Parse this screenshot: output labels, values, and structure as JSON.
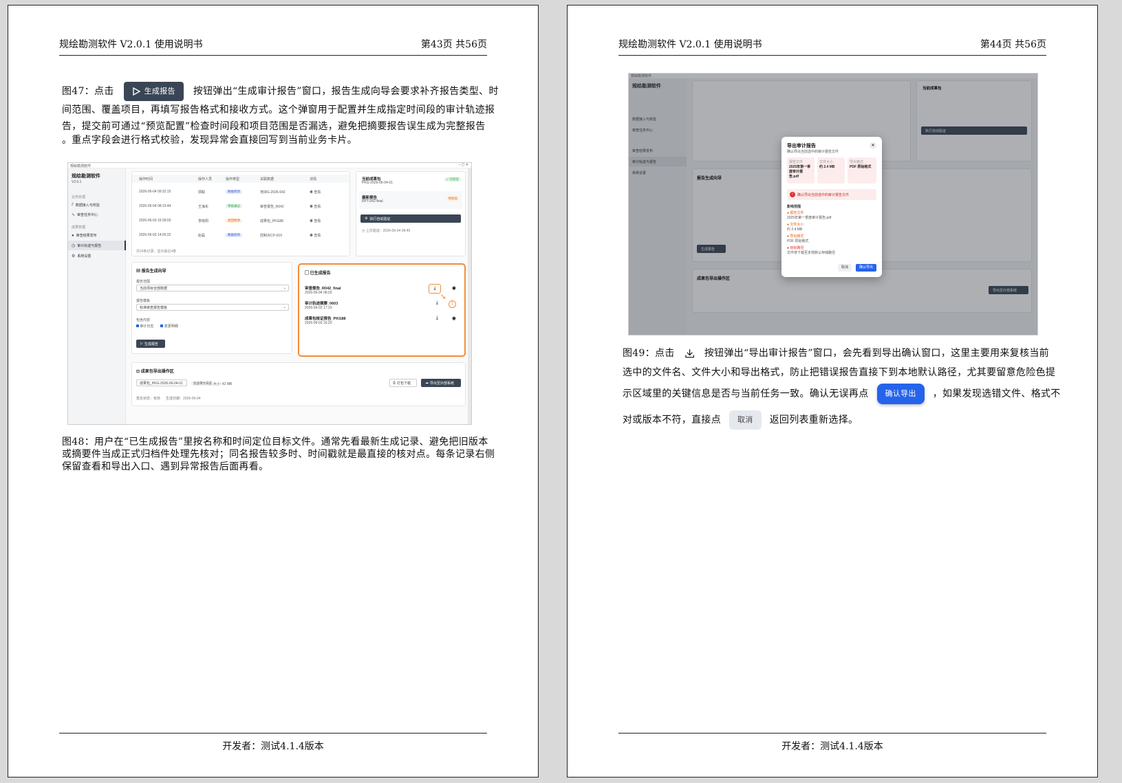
{
  "doc_title": "规绘勘测软件 V2.0.1 使用说明书",
  "footer": "开发者：测试4.1.4版本",
  "left_page": {
    "page_num": "第43页  共56页",
    "fig47": {
      "prefix": "图47：点击",
      "button_label": "生成报告",
      "line1_rest": "按钮弹出“生成审计报告”窗口，报告生成向导会要求补齐报告类型、时",
      "line2": "间范围、覆盖项目，再填写报告格式和接收方式。这个弹窗用于配置并生成指定时间段的审计轨迹报",
      "line3": "告，提交前可通过“预览配置”检查时间段和项目范围是否漏选，避免把摘要报告误生成为完整报告",
      "line4": "。重点字段会进行格式校验，发现异常会直接回写到当前业务卡片。"
    },
    "fig48": {
      "line1": "图48：用户在“已生成报告”里按名称和时间定位目标文件。通常先看最新生成记录、避免把旧版本",
      "line2": "或摘要件当成正式归档件处理先核对；同名报告较多时、时间戳就是最直接的核对点。每条记录右侧",
      "line3": "保留查看和导出入口、遇到异常报告后面再看。"
    }
  },
  "right_page": {
    "page_num": "第44页  共56页",
    "fig49": {
      "prefix": "图49：点击",
      "line1_rest": "按钮弹出“导出审计报告”窗口，会先看到导出确认窗口，这里主要用来复核当前",
      "line2": "选中的文件名、文件大小和导出格式，防止把错误报告直接下到本地默认路径，尤其要留意危险色提",
      "line3a": "示区域里的关键信息是否与当前任务一致。确认无误再点",
      "confirm_label": "确认导出",
      "line3b": "，如果发现选错文件、格式不",
      "line4a": "对或版本不符，直接点",
      "cancel_label": "取消",
      "line4b": "返回列表重新选择。"
    }
  },
  "app": {
    "window_title": "规绘勘测软件",
    "app_name": "规绘勘测软件",
    "version": "V2.0.1",
    "nav_group1": "业务处理",
    "nav_import": "数据接入与校验",
    "nav_tasks": "审查任务中心",
    "nav_group2": "成果管理",
    "nav_results": "审查结果发布",
    "nav_audit": "审计轨迹与报告",
    "nav_settings": "系统设置",
    "table_headers": [
      "操作时间",
      "操作人员",
      "操作类型",
      "关联数据",
      "详情"
    ],
    "rows": [
      {
        "time": "2026-06-04 09:32:15",
        "user": "郭毅",
        "type": "数据修改",
        "data": "地块G-2026-042",
        "view": "查看"
      },
      {
        "time": "2026-06-04 08:15:44",
        "user": "王海东",
        "type": "审核通过",
        "data": "审查报告_R042",
        "view": "查看"
      },
      {
        "time": "2026-06-03 16:28:03",
        "user": "李晓阳",
        "type": "退回修改",
        "data": "成果包_PKG88",
        "view": "查看"
      },
      {
        "time": "2026-06-03 14:05:22",
        "user": "赵磊",
        "type": "数据修改",
        "data": "控制点CP-019",
        "view": "查看"
      }
    ],
    "table_footer": "共24条记录，显示最近4条",
    "pkg_title": "当前成果包",
    "pkg_id": "PKG-2026-06-04-01",
    "pkg_status": "已验证",
    "latest_title": "最新报告",
    "latest_id": "RPT-042-final",
    "latest_status": "待验证",
    "verify_btn": "执行自动验证",
    "last_verify": "上次验证：2026-06-04 09:40",
    "gen_title": "报告生成向导",
    "scope_label": "报告范围",
    "scope_value": "当前项目全部数据",
    "tpl_label": "报告模板",
    "tpl_value": "标准审查报告模板",
    "include_label": "包含内容",
    "opt1": "审计日志",
    "opt2": "变更明细",
    "gen_btn": "生成报告",
    "reports_title": "已生成报告",
    "reports": [
      {
        "name": "审查报告_R042_final",
        "time": "2026-06-04 08:20"
      },
      {
        "name": "审计轨迹摘要_0603",
        "time": "2026-06-03 17:10"
      },
      {
        "name": "成果包核证报告_PKG88",
        "time": "2026-06-03 16:25"
      }
    ],
    "callout_num": "1",
    "export_title": "成果包导出操作区",
    "export_select": "成果包_PKG-2026-06-04-01",
    "export_check": "包含审计日志",
    "export_size": "大小: 42 MB",
    "pack_btn": "打包下载",
    "push_btn": "导出至外部系统",
    "export_meta1": "签名状态：有效",
    "export_meta2": "生成日期：2026-06-04"
  },
  "dialog": {
    "title": "导出审计报告",
    "subtitle": "确认导出当前选中的审计报告文件",
    "file_label": "报告文件",
    "file_value": "2025年第一季度审计报告.pdf",
    "size_label": "文件大小",
    "size_value": "约 2.4 MB",
    "fmt_label": "导出格式",
    "fmt_value": "PDF 原始格式",
    "warn": "确认导出当前选中的审计报告文件",
    "impact_title": "影响范围",
    "items": [
      {
        "k": "报告文件",
        "v": "2025年第一季度审计报告.pdf"
      },
      {
        "k": "文件大小",
        "v": "约 2.4 MB"
      },
      {
        "k": "导出格式",
        "v": "PDF 原始格式"
      },
      {
        "k": "目标路径",
        "v": "文件将下载至本地默认存储路径"
      }
    ],
    "cancel": "取消",
    "confirm": "确认导出"
  },
  "colors": {
    "accent": "#2563eb",
    "highlight": "#f28c38",
    "dark_button": "#3a4655"
  }
}
